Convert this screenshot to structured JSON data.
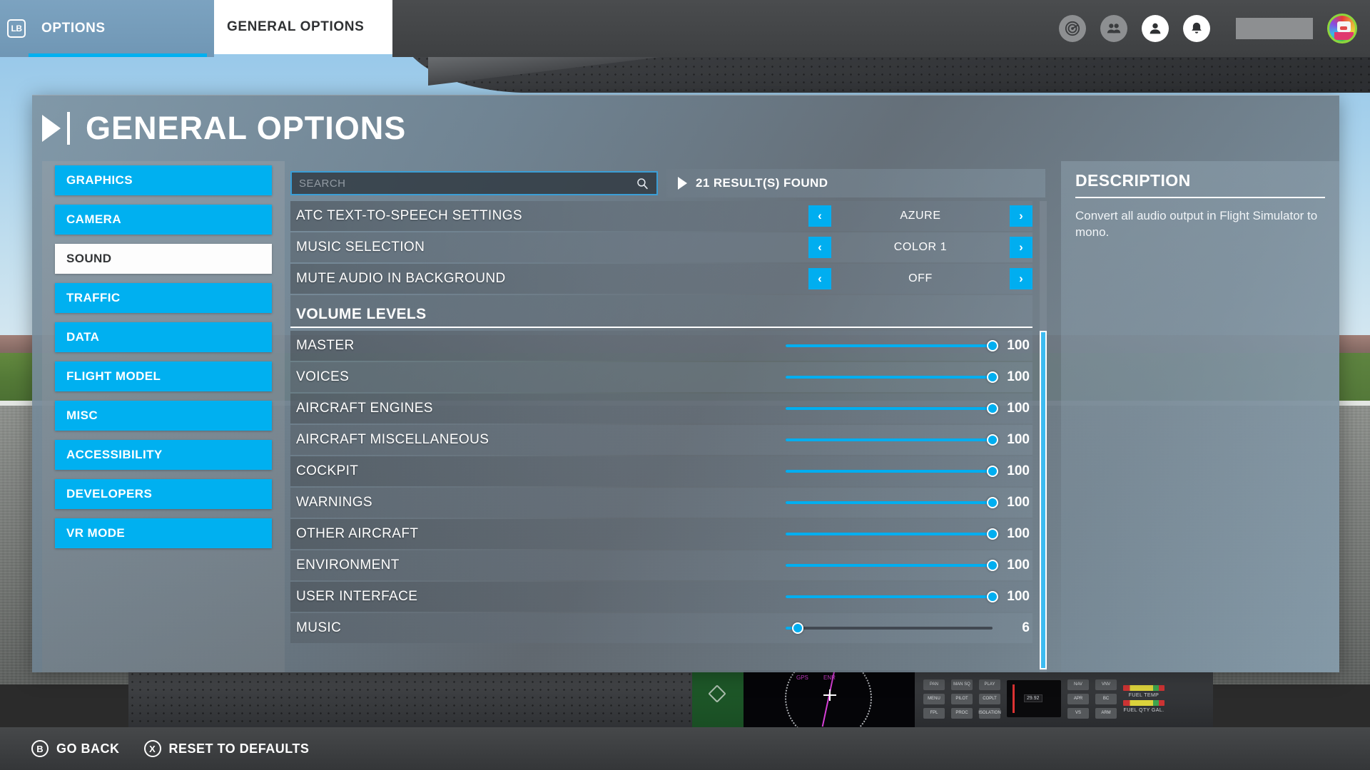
{
  "topbar": {
    "bumper_hint": "LB",
    "left_tab": "OPTIONS",
    "active_tab": "GENERAL OPTIONS",
    "icons": [
      "radar-icon",
      "friends-icon",
      "profile-icon",
      "notifications-icon"
    ],
    "profile_name": ""
  },
  "page": {
    "title": "GENERAL OPTIONS"
  },
  "sidebar": {
    "items": [
      {
        "label": "GRAPHICS",
        "active": false
      },
      {
        "label": "CAMERA",
        "active": false
      },
      {
        "label": "SOUND",
        "active": true
      },
      {
        "label": "TRAFFIC",
        "active": false
      },
      {
        "label": "DATA",
        "active": false
      },
      {
        "label": "FLIGHT MODEL",
        "active": false
      },
      {
        "label": "MISC",
        "active": false
      },
      {
        "label": "ACCESSIBILITY",
        "active": false
      },
      {
        "label": "DEVELOPERS",
        "active": false
      },
      {
        "label": "VR MODE",
        "active": false
      }
    ]
  },
  "search": {
    "value": "",
    "placeholder": "SEARCH",
    "results_text": "21 RESULT(S) FOUND"
  },
  "settings": {
    "options": [
      {
        "label": "ATC TEXT-TO-SPEECH SETTINGS",
        "value": "AZURE",
        "prev": "‹",
        "next": "›"
      },
      {
        "label": "MUSIC SELECTION",
        "value": "COLOR 1",
        "prev": "‹",
        "next": "›"
      },
      {
        "label": "MUTE AUDIO IN BACKGROUND",
        "value": "OFF",
        "prev": "‹",
        "next": "›"
      }
    ],
    "section_title": "VOLUME LEVELS",
    "sliders": [
      {
        "label": "MASTER",
        "value": 100,
        "max": 100
      },
      {
        "label": "VOICES",
        "value": 100,
        "max": 100
      },
      {
        "label": "AIRCRAFT ENGINES",
        "value": 100,
        "max": 100
      },
      {
        "label": "AIRCRAFT MISCELLANEOUS",
        "value": 100,
        "max": 100
      },
      {
        "label": "COCKPIT",
        "value": 100,
        "max": 100
      },
      {
        "label": "WARNINGS",
        "value": 100,
        "max": 100
      },
      {
        "label": "OTHER AIRCRAFT",
        "value": 100,
        "max": 100
      },
      {
        "label": "ENVIRONMENT",
        "value": 100,
        "max": 100
      },
      {
        "label": "USER INTERFACE",
        "value": 100,
        "max": 100
      },
      {
        "label": "MUSIC",
        "value": 6,
        "max": 100
      }
    ]
  },
  "description": {
    "title": "DESCRIPTION",
    "text": "Convert all audio output in Flight Simulator to mono."
  },
  "bottombar": {
    "actions": [
      {
        "glyph": "B",
        "label": "GO BACK"
      },
      {
        "glyph": "X",
        "label": "RESET TO DEFAULTS"
      }
    ]
  },
  "cockpit": {
    "pfd_labels": [
      "GPS",
      "ENR"
    ],
    "radio_buttons": [
      "PAN",
      "MAN SQ",
      "PLAY",
      "MENU",
      "PILOT",
      "COPLT",
      "ISOLATION",
      "FPL",
      "PROC",
      "NAV",
      "VNV",
      "APR",
      "BC",
      "VS",
      "ARM"
    ],
    "gauge_labels": [
      "FUEL TEMP",
      "FUEL QTY GAL."
    ],
    "cdu_value": "29.92"
  },
  "colors": {
    "accent": "#00b0f0",
    "accent_dark": "#00aef0",
    "active_tab_bg": "#ffffff",
    "scroll_thumb": "#3dbbf0",
    "avatar_ring": "#8ed63c"
  }
}
